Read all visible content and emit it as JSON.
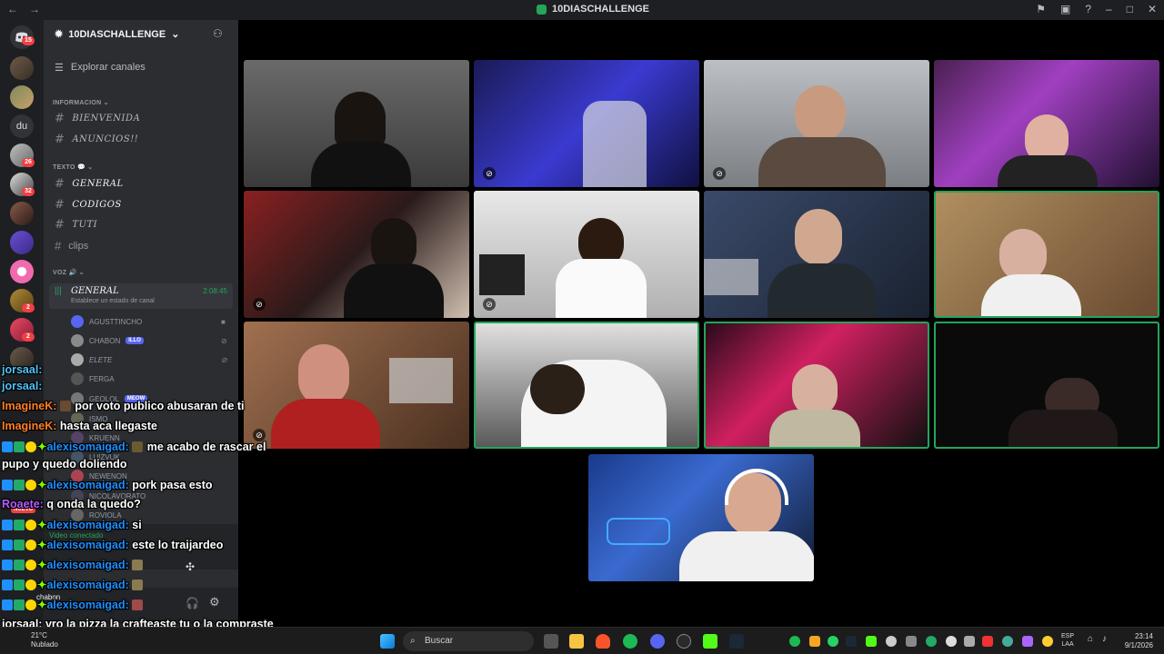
{
  "window": {
    "title": "10DIASCHALLENGE",
    "nav_back": "←",
    "nav_forward": "→"
  },
  "guild_badges": [
    "15",
    "26",
    "32",
    "2",
    "2"
  ],
  "guild_text_icon": "du",
  "server": {
    "name": "10DIASCHALLENGE",
    "explore": "Explorar canales",
    "categories": {
      "info": "INFORMACION",
      "text": "TEXTO",
      "voice": "VOZ"
    },
    "info_channels": [
      "BIENVENIDA",
      "ANUNCIOS!!"
    ],
    "text_channels": [
      "GENERAL",
      "CODIGOS",
      "TUTI",
      "clips"
    ],
    "voice_channel": {
      "name": "GENERAL",
      "timer": "2:08:45",
      "status_placeholder": "Establece un estado de canal"
    },
    "voice_members": [
      {
        "name": "AGUSTTINCHO",
        "tag": ""
      },
      {
        "name": "CHABON",
        "tag": "ILLO"
      },
      {
        "name": "ELETE",
        "tag": ""
      },
      {
        "name": "FERGA",
        "tag": ""
      },
      {
        "name": "GEOLOL",
        "tag": "MEOW"
      },
      {
        "name": "ISMO",
        "tag": ""
      },
      {
        "name": "KRUENN",
        "tag": ""
      },
      {
        "name": "LUIZVUK",
        "tag": ""
      },
      {
        "name": "NEWENON",
        "tag": ""
      },
      {
        "name": "NICOLAVORATO",
        "tag": ""
      },
      {
        "name": "ROVIOLA",
        "tag": ""
      }
    ],
    "voice_connected": "Video conectado",
    "user_name": "chabon",
    "new_badge": "NUEVO"
  },
  "chat": [
    {
      "user": "jorsaal:",
      "msg": "",
      "color": "#4fc3f7"
    },
    {
      "user": "ImagineK:",
      "msg": "por voto publico abusaran de ti",
      "color": "#ff7f24"
    },
    {
      "user": "ImagineK:",
      "msg": "hasta aca llegaste",
      "color": "#ff7f24"
    },
    {
      "user": "alexisomaigad:",
      "msg": "me acabo de rascar el",
      "color": "#1e90ff"
    },
    {
      "user": "",
      "msg": "pupo y quedo doliendo",
      "color": "#ffffff"
    },
    {
      "user": "alexisomaigad:",
      "msg": "pork pasa esto",
      "color": "#1e90ff"
    },
    {
      "user": "Roaete:",
      "msg": "q onda la quedo?",
      "color": "#b35cff"
    },
    {
      "user": "alexisomaigad:",
      "msg": "si",
      "color": "#1e90ff"
    },
    {
      "user": "alexisomaigad:",
      "msg": "este lo traijardeo",
      "color": "#1e90ff"
    },
    {
      "user": "alexisomaigad:",
      "msg": "",
      "color": "#1e90ff"
    },
    {
      "user": "alexisomaigad:",
      "msg": "",
      "color": "#1e90ff"
    },
    {
      "user": "alexisomaigad:",
      "msg": "",
      "color": "#1e90ff"
    },
    {
      "user": "jorsaal:",
      "msg": "vro la pizza la crafteaste tu o la compraste",
      "color": "#4fc3f7"
    }
  ],
  "chat_header_user": "jorsaal:",
  "taskbar": {
    "search_placeholder": "Buscar",
    "weather_temp": "21°C",
    "weather_desc": "Nublado",
    "lang_top": "ESP",
    "lang_bottom": "LAA",
    "time": "23:14",
    "date": "9/1/2026"
  },
  "colors": {
    "speaking_border": "#23a55a",
    "accent": "#5865f2"
  }
}
